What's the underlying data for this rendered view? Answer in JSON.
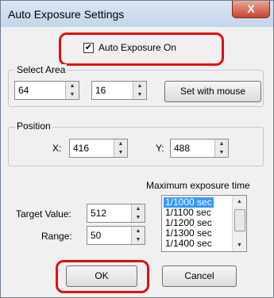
{
  "window": {
    "title": "Auto Exposure Settings",
    "close_glyph": "X"
  },
  "auto_exposure": {
    "label": "Auto Exposure On",
    "checked": true,
    "check_glyph": "✔"
  },
  "select_area": {
    "caption": "Select Area",
    "width_value": "64",
    "height_value": "16",
    "set_with_mouse_label": "Set with mouse"
  },
  "position": {
    "caption": "Position",
    "x_label": "X:",
    "x_value": "416",
    "y_label": "Y:",
    "y_value": "488"
  },
  "exposure": {
    "max_time_label": "Maximum exposure time",
    "options": [
      "1/1000 sec",
      "1/1100 sec",
      "1/1200 sec",
      "1/1300 sec",
      "1/1400 sec"
    ],
    "selected": "1/1000 sec"
  },
  "target": {
    "label": "Target Value:",
    "value": "512"
  },
  "range": {
    "label": "Range:",
    "value": "50"
  },
  "buttons": {
    "ok_label": "OK",
    "cancel_label": "Cancel"
  },
  "colors": {
    "highlight": "#e01010",
    "selection": "#3399ff"
  }
}
